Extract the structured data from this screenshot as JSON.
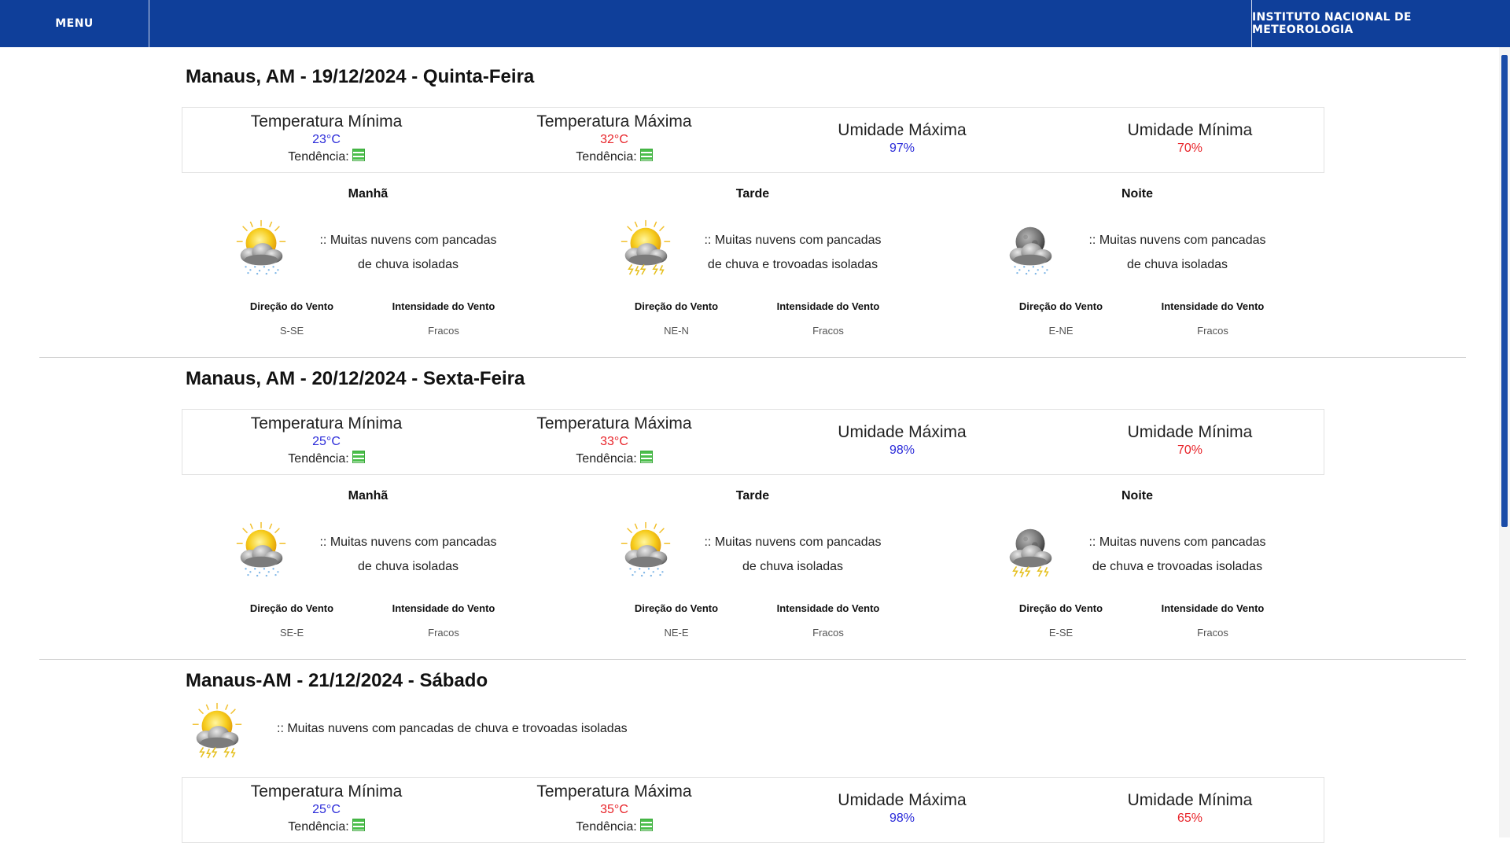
{
  "topbar": {
    "menu_label": "MENU",
    "org_label": "INSTITUTO NACIONAL DE METEOROLOGIA"
  },
  "labels": {
    "temp_min": "Temperatura Mínima",
    "temp_max": "Temperatura Máxima",
    "hum_max": "Umidade Máxima",
    "hum_min": "Umidade Mínima",
    "tendencia": "Tendência:",
    "wind_dir": "Direção do Vento",
    "wind_int": "Intensidade do Vento"
  },
  "colors": {
    "topbar": "#0f3f9a",
    "min_value": "#2b2bd9",
    "max_value": "#e8242a",
    "trend": "#4bbf4b"
  },
  "days": [
    {
      "title": "Manaus, AM - 19/12/2024 - Quinta-Feira",
      "temp_min": "23°C",
      "temp_max": "32°C",
      "hum_max": "97%",
      "hum_min": "70%",
      "periods": [
        {
          "name": "Manhã",
          "icon": "sun-cloud-rain-icon",
          "desc1": ":: Muitas nuvens com pancadas",
          "desc2": "de chuva isoladas",
          "wind_dir": "S-SE",
          "wind_int": "Fracos"
        },
        {
          "name": "Tarde",
          "icon": "sun-cloud-storm-icon",
          "desc1": ":: Muitas nuvens com pancadas",
          "desc2": "de chuva e trovoadas isoladas",
          "wind_dir": "NE-N",
          "wind_int": "Fracos"
        },
        {
          "name": "Noite",
          "icon": "moon-cloud-rain-icon",
          "desc1": ":: Muitas nuvens com pancadas",
          "desc2": "de chuva isoladas",
          "wind_dir": "E-NE",
          "wind_int": "Fracos"
        }
      ]
    },
    {
      "title": "Manaus, AM - 20/12/2024 - Sexta-Feira",
      "temp_min": "25°C",
      "temp_max": "33°C",
      "hum_max": "98%",
      "hum_min": "70%",
      "periods": [
        {
          "name": "Manhã",
          "icon": "sun-cloud-rain-icon",
          "desc1": ":: Muitas nuvens com pancadas",
          "desc2": "de chuva isoladas",
          "wind_dir": "SE-E",
          "wind_int": "Fracos"
        },
        {
          "name": "Tarde",
          "icon": "sun-cloud-rain-icon",
          "desc1": ":: Muitas nuvens com pancadas",
          "desc2": "de chuva isoladas",
          "wind_dir": "NE-E",
          "wind_int": "Fracos"
        },
        {
          "name": "Noite",
          "icon": "moon-cloud-storm-icon",
          "desc1": ":: Muitas nuvens com pancadas",
          "desc2": "de chuva e trovoadas isoladas",
          "wind_dir": "E-SE",
          "wind_int": "Fracos"
        }
      ]
    },
    {
      "title": "Manaus-AM - 21/12/2024 - Sábado",
      "summary_icon": "sun-cloud-storm-icon",
      "summary_desc": ":: Muitas nuvens com pancadas de chuva e trovoadas isoladas",
      "temp_min": "25°C",
      "temp_max": "35°C",
      "hum_max": "98%",
      "hum_min": "65%"
    }
  ]
}
